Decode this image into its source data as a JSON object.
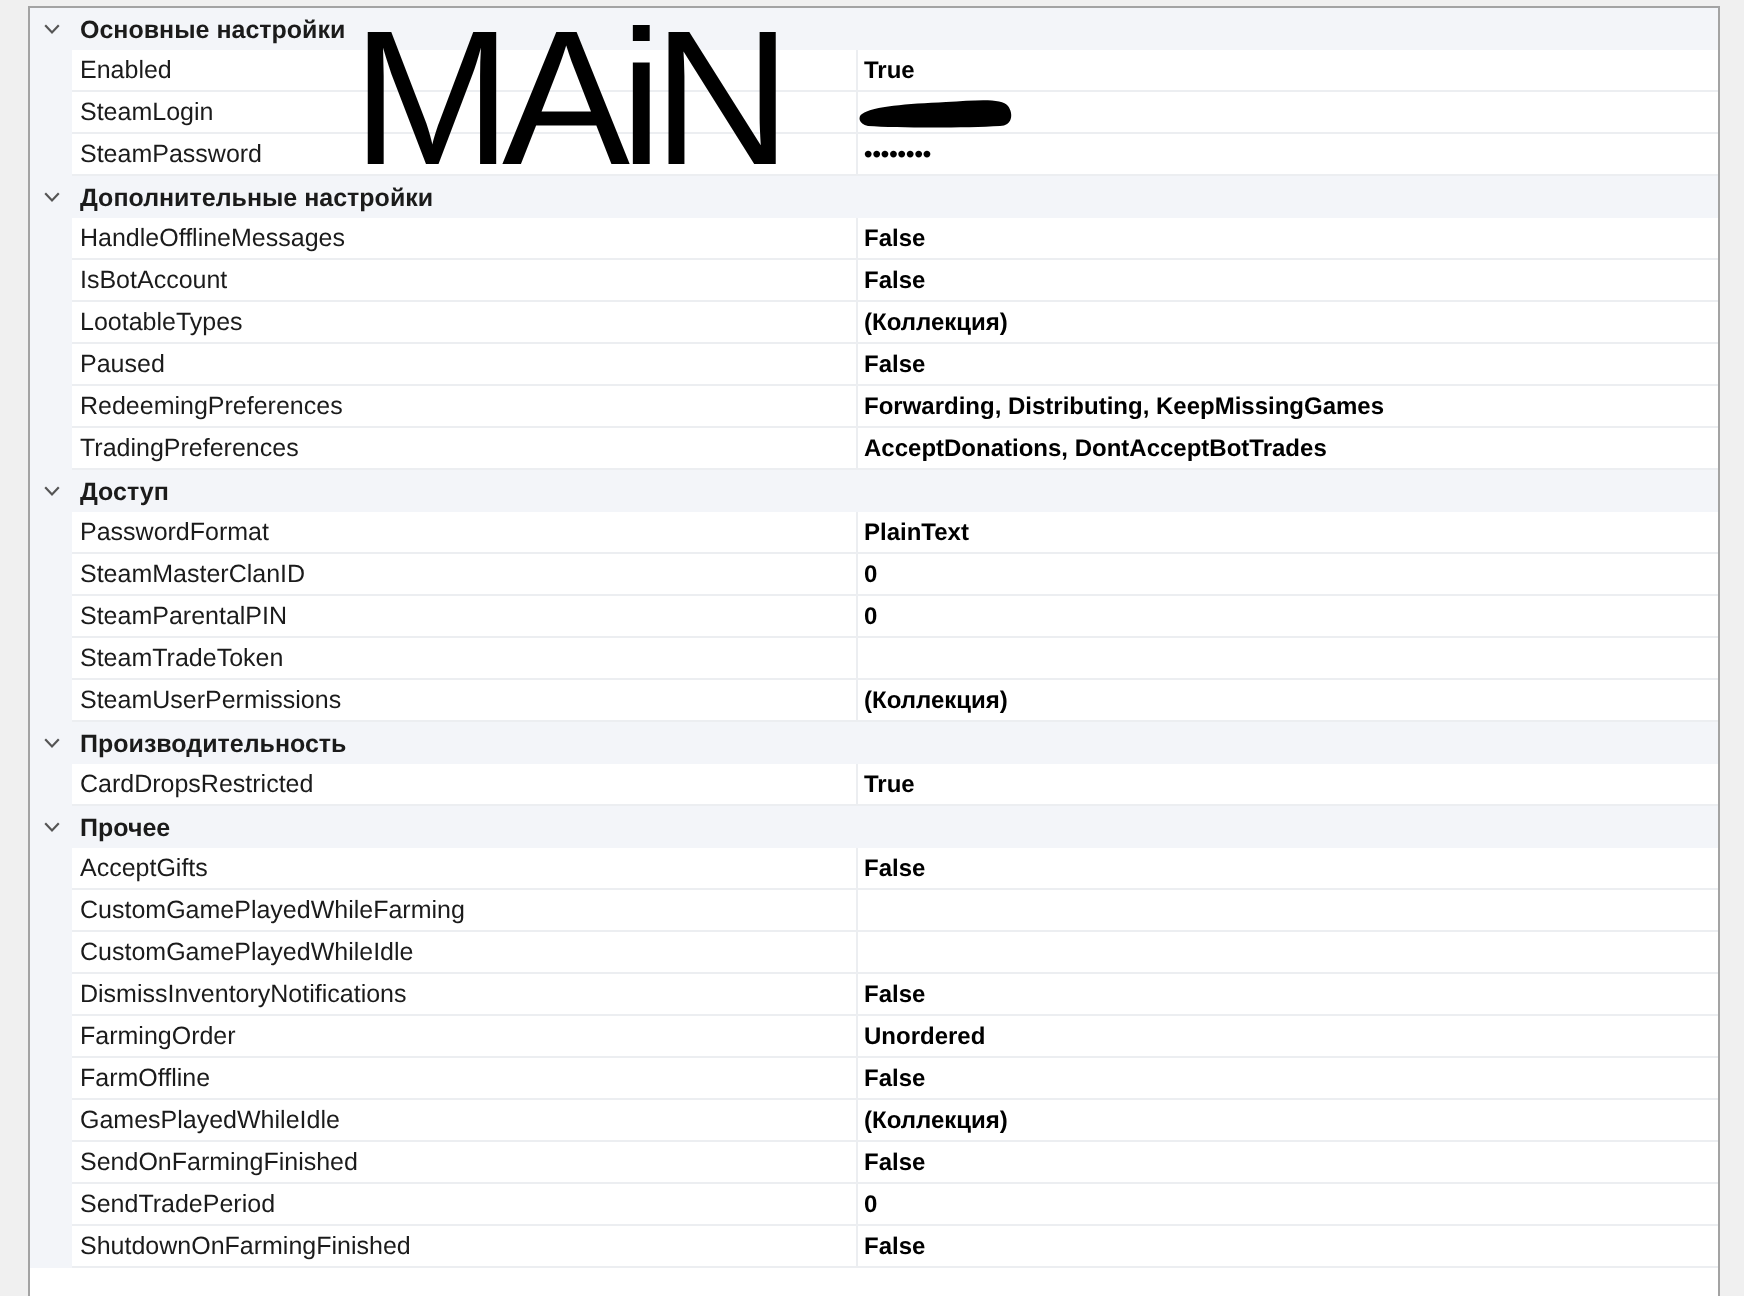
{
  "categories": [
    {
      "title": "Основные настройки",
      "expanded": true,
      "properties": [
        {
          "name": "Enabled",
          "value": "True",
          "redacted": false
        },
        {
          "name": "SteamLogin",
          "redacted": true
        },
        {
          "name": "SteamPassword",
          "value": "••••••••",
          "redacted": false
        }
      ]
    },
    {
      "title": "Дополнительные настройки",
      "expanded": true,
      "properties": [
        {
          "name": "HandleOfflineMessages",
          "value": "False",
          "redacted": false
        },
        {
          "name": "IsBotAccount",
          "value": "False",
          "redacted": false
        },
        {
          "name": "LootableTypes",
          "value": "(Коллекция)",
          "redacted": false
        },
        {
          "name": "Paused",
          "value": "False",
          "redacted": false
        },
        {
          "name": "RedeemingPreferences",
          "value": "Forwarding, Distributing, KeepMissingGames",
          "redacted": false
        },
        {
          "name": "TradingPreferences",
          "value": "AcceptDonations, DontAcceptBotTrades",
          "redacted": false
        }
      ]
    },
    {
      "title": "Доступ",
      "expanded": true,
      "properties": [
        {
          "name": "PasswordFormat",
          "value": "PlainText",
          "redacted": false
        },
        {
          "name": "SteamMasterClanID",
          "value": "0",
          "redacted": false
        },
        {
          "name": "SteamParentalPIN",
          "value": "0",
          "redacted": false
        },
        {
          "name": "SteamTradeToken",
          "redacted": false
        },
        {
          "name": "SteamUserPermissions",
          "value": "(Коллекция)",
          "redacted": false
        }
      ]
    },
    {
      "title": "Производительность",
      "expanded": true,
      "properties": [
        {
          "name": "CardDropsRestricted",
          "value": "True",
          "redacted": false
        }
      ]
    },
    {
      "title": "Прочее",
      "expanded": true,
      "properties": [
        {
          "name": "AcceptGifts",
          "value": "False",
          "redacted": false
        },
        {
          "name": "CustomGamePlayedWhileFarming",
          "redacted": false
        },
        {
          "name": "CustomGamePlayedWhileIdle",
          "redacted": false
        },
        {
          "name": "DismissInventoryNotifications",
          "value": "False",
          "redacted": false
        },
        {
          "name": "FarmingOrder",
          "value": "Unordered",
          "redacted": false
        },
        {
          "name": "FarmOffline",
          "value": "False",
          "redacted": false
        },
        {
          "name": "GamesPlayedWhileIdle",
          "value": "(Коллекция)",
          "redacted": false
        },
        {
          "name": "SendOnFarmingFinished",
          "value": "False",
          "redacted": false
        },
        {
          "name": "SendTradePeriod",
          "value": "0",
          "redacted": false
        },
        {
          "name": "ShutdownOnFarmingFinished",
          "value": "False",
          "redacted": false
        }
      ]
    }
  ],
  "annotations": [
    {
      "kind": "handwriting",
      "text": "MAiN"
    }
  ]
}
